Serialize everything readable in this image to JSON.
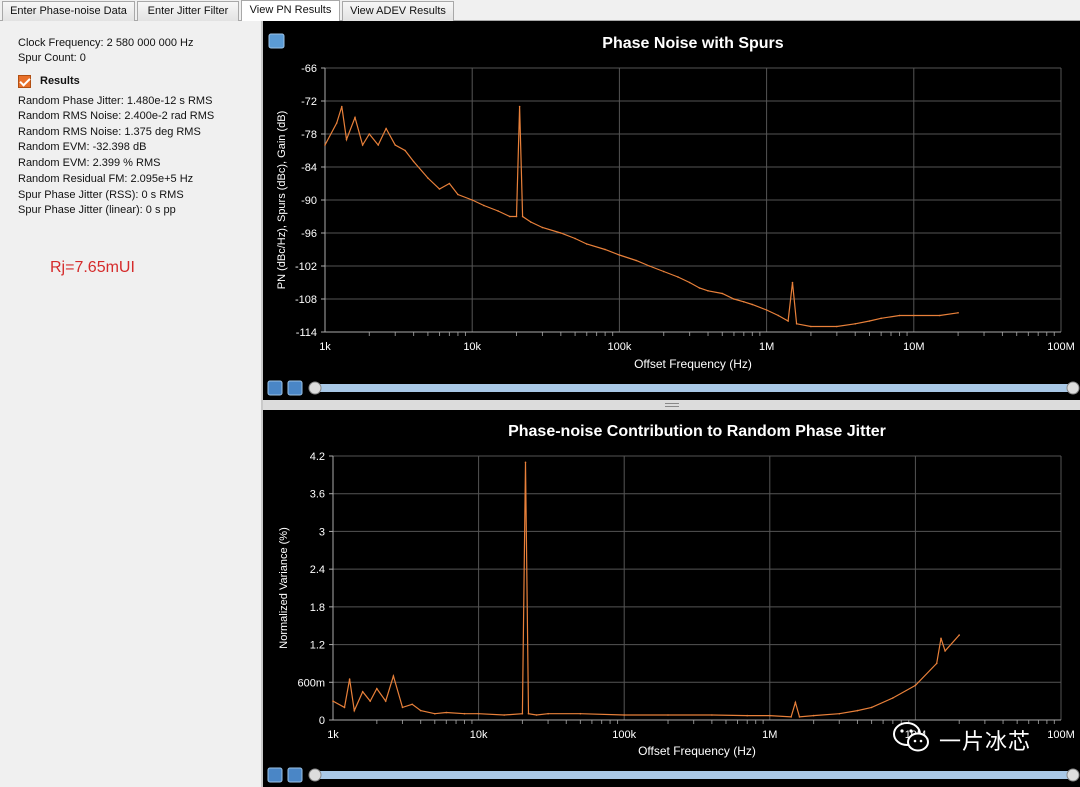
{
  "tabs": [
    {
      "label": "Enter Phase-noise Data",
      "active": false
    },
    {
      "label": "Enter Jitter Filter",
      "active": false
    },
    {
      "label": "View PN Results",
      "active": true
    },
    {
      "label": "View ADEV Results",
      "active": false
    }
  ],
  "left_panel": {
    "clock_frequency": "Clock Frequency:  2 580 000 000 Hz",
    "spur_count": "Spur Count:  0",
    "results_label": "Results",
    "results_checked": true,
    "results": [
      "Random Phase Jitter:  1.480e-12 s RMS",
      "Random RMS Noise:  2.400e-2 rad RMS",
      "Random RMS Noise:  1.375 deg RMS",
      "Random EVM:  -32.398 dB",
      "Random EVM:  2.399 % RMS",
      "Random Residual FM:  2.095e+5 Hz",
      "Spur Phase Jitter (RSS):  0 s RMS",
      "Spur Phase Jitter (linear):  0 s pp"
    ],
    "annotation": "Rj=7.65mUI",
    "annotation_color": "#d52b2b"
  },
  "watermark": {
    "text": "一片冰芯",
    "icon": "wechat-icon"
  },
  "colors": {
    "trace": "#e8803a",
    "background": "#000000",
    "grid": "#555555",
    "scrollbar": "#a9c8e6"
  },
  "chart_data": [
    {
      "type": "line",
      "title": "Phase Noise with Spurs",
      "xlabel": "Offset Frequency (Hz)",
      "ylabel": "PN (dBc/Hz), Spurs (dBc), Gain (dB)",
      "x_scale": "log",
      "xlim": [
        1000,
        100000000
      ],
      "ylim": [
        -114,
        -66
      ],
      "x_tick_labels": [
        "1k",
        "10k",
        "100k",
        "1M",
        "10M",
        "100M"
      ],
      "y_tick_labels": [
        "-66",
        "-72",
        "-78",
        "-84",
        "-90",
        "-96",
        "-102",
        "-108",
        "-114"
      ],
      "grid": true,
      "series": [
        {
          "color": "#e8803a",
          "x": [
            1000,
            1200,
            1300,
            1400,
            1600,
            1800,
            2000,
            2300,
            2600,
            3000,
            3500,
            4000,
            5000,
            6000,
            7000,
            8000,
            10000,
            12000,
            15000,
            18000,
            20000,
            21000,
            22000,
            25000,
            30000,
            40000,
            50000,
            60000,
            80000,
            100000,
            130000,
            160000,
            200000,
            250000,
            300000,
            350000,
            400000,
            500000,
            600000,
            700000,
            800000,
            1000000,
            1200000,
            1400000,
            1500000,
            1600000,
            2000000,
            3000000,
            4000000,
            5000000,
            6000000,
            8000000,
            10000000,
            15000000,
            20000000
          ],
          "y": [
            -80,
            -76,
            -73,
            -79,
            -75,
            -80,
            -78,
            -80,
            -77,
            -80,
            -81,
            -83,
            -86,
            -88,
            -87,
            -89,
            -90,
            -91,
            -92,
            -93,
            -93,
            -73,
            -93,
            -94,
            -95,
            -96,
            -97,
            -98,
            -99,
            -100,
            -101,
            -102,
            -103,
            -104,
            -105,
            -106,
            -106.5,
            -107,
            -108,
            -108.5,
            -109,
            -110,
            -111,
            -112,
            -105,
            -112.5,
            -113,
            -113,
            -112.5,
            -112,
            -111.5,
            -111,
            -111,
            -111,
            -110.5
          ]
        }
      ]
    },
    {
      "type": "line",
      "title": "Phase-noise Contribution to Random Phase Jitter",
      "xlabel": "Offset Frequency (Hz)",
      "ylabel": "Normalized Variance (%)",
      "x_scale": "log",
      "xlim": [
        1000,
        100000000
      ],
      "ylim": [
        0,
        4.2
      ],
      "x_tick_labels": [
        "1k",
        "10k",
        "100k",
        "1M",
        "10M",
        "100M"
      ],
      "y_tick_labels": [
        "0",
        "600m",
        "1.2",
        "1.8",
        "2.4",
        "3",
        "3.6",
        "4.2"
      ],
      "grid": true,
      "series": [
        {
          "color": "#e8803a",
          "x": [
            1000,
            1200,
            1300,
            1400,
            1600,
            1800,
            2000,
            2300,
            2600,
            3000,
            3500,
            4000,
            5000,
            6000,
            8000,
            10000,
            15000,
            20000,
            21000,
            22000,
            25000,
            30000,
            50000,
            100000,
            200000,
            400000,
            700000,
            1000000,
            1400000,
            1500000,
            1600000,
            2000000,
            3000000,
            4000000,
            5000000,
            7000000,
            10000000,
            14000000,
            15000000,
            16000000,
            20000000
          ],
          "y": [
            0.3,
            0.2,
            0.65,
            0.15,
            0.45,
            0.3,
            0.5,
            0.3,
            0.7,
            0.2,
            0.25,
            0.15,
            0.1,
            0.12,
            0.1,
            0.1,
            0.08,
            0.1,
            4.1,
            0.1,
            0.08,
            0.1,
            0.1,
            0.08,
            0.08,
            0.08,
            0.07,
            0.07,
            0.05,
            0.28,
            0.05,
            0.07,
            0.1,
            0.15,
            0.2,
            0.35,
            0.55,
            0.9,
            1.3,
            1.1,
            1.35
          ]
        }
      ]
    }
  ]
}
